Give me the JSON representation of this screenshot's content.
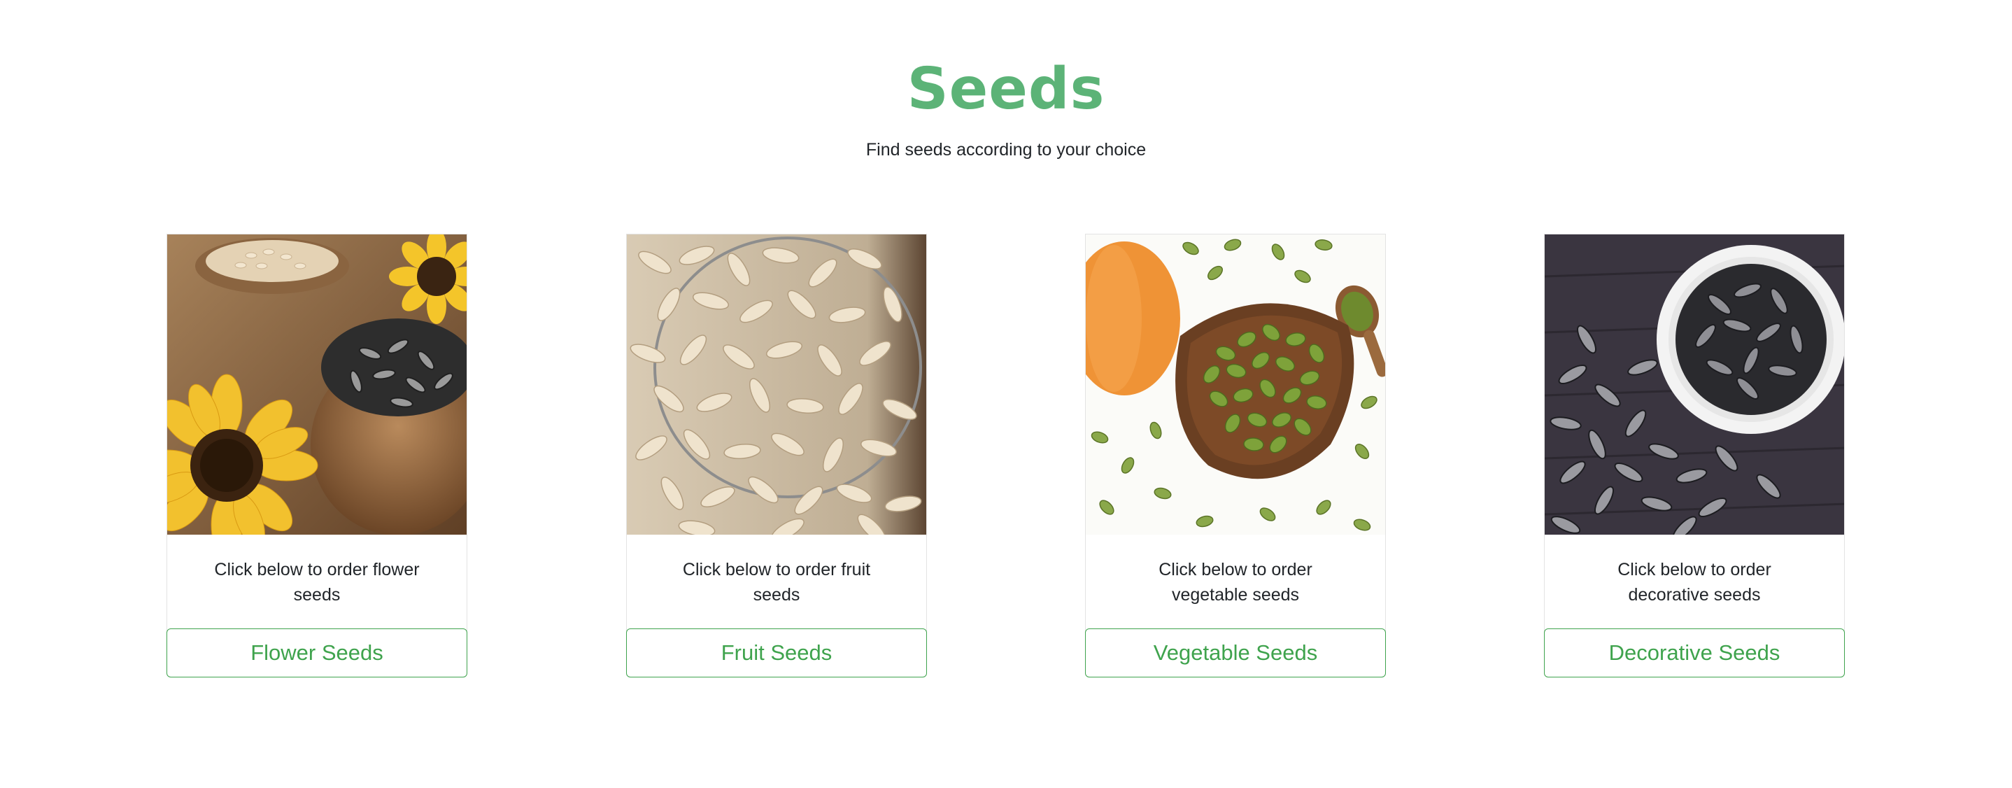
{
  "page": {
    "title": "Seeds",
    "subtitle": "Find seeds according to your choice"
  },
  "colors": {
    "accent": "#5cb377",
    "button": "#3fa34d",
    "text": "#212529"
  },
  "cards": [
    {
      "image": "sunflower-seeds-photo",
      "text": "Click below to order flower seeds",
      "button_label": "Flower Seeds"
    },
    {
      "image": "melon-seeds-bowl-photo",
      "text": "Click below to order fruit seeds",
      "button_label": "Fruit Seeds"
    },
    {
      "image": "pumpkin-seeds-photo",
      "text": "Click below to order vegetable seeds",
      "button_label": "Vegetable Seeds"
    },
    {
      "image": "striped-seeds-bowl-photo",
      "text": "Click below to order decorative seeds",
      "button_label": "Decorative Seeds"
    }
  ]
}
